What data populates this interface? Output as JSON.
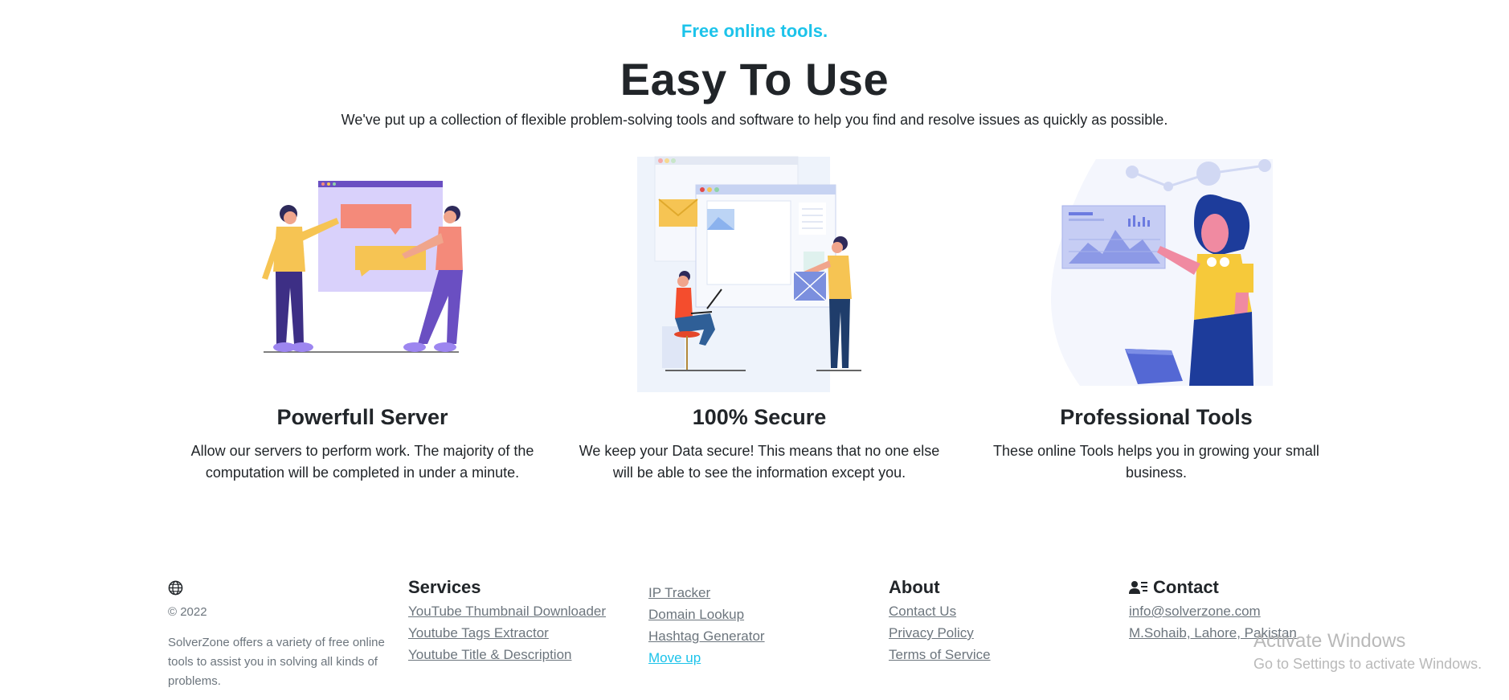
{
  "hero": {
    "eyebrow": "Free online tools.",
    "title": "Easy To Use",
    "lead": "We've put up a collection of flexible problem-solving tools and software to help you find and resolve issues as quickly as possible."
  },
  "features": [
    {
      "title": "Powerfull Server",
      "text": "Allow our servers to perform work. The majority of the computation will be completed in under a minute."
    },
    {
      "title": "100% Secure",
      "text": "We keep your Data secure! This means that no one else will be able to see the information except you."
    },
    {
      "title": "Professional Tools",
      "text": "These online Tools helps you in growing your small business."
    }
  ],
  "footer": {
    "brand": {
      "copyright": "© 2022",
      "about": "SolverZone offers a variety of free online tools to assist you in solving all kinds of problems."
    },
    "services": {
      "heading": "Services",
      "links": [
        "YouTube Thumbnail Downloader",
        "Youtube Tags Extractor",
        "Youtube Title & Description"
      ]
    },
    "more": {
      "links": [
        "IP Tracker",
        "Domain Lookup",
        "Hashtag Generator",
        "Move up"
      ]
    },
    "about": {
      "heading": "About",
      "links": [
        "Contact Us",
        "Privacy Policy",
        "Terms of Service"
      ]
    },
    "contact": {
      "heading": "Contact",
      "email": "info@solverzone.com",
      "address": "M.Sohaib, Lahore, Pakistan"
    }
  },
  "watermark": {
    "line1": "Activate Windows",
    "line2": "Go to Settings to activate Windows."
  },
  "colors": {
    "accent": "#1cc3ea",
    "text": "#212529",
    "muted": "#6c757d"
  }
}
